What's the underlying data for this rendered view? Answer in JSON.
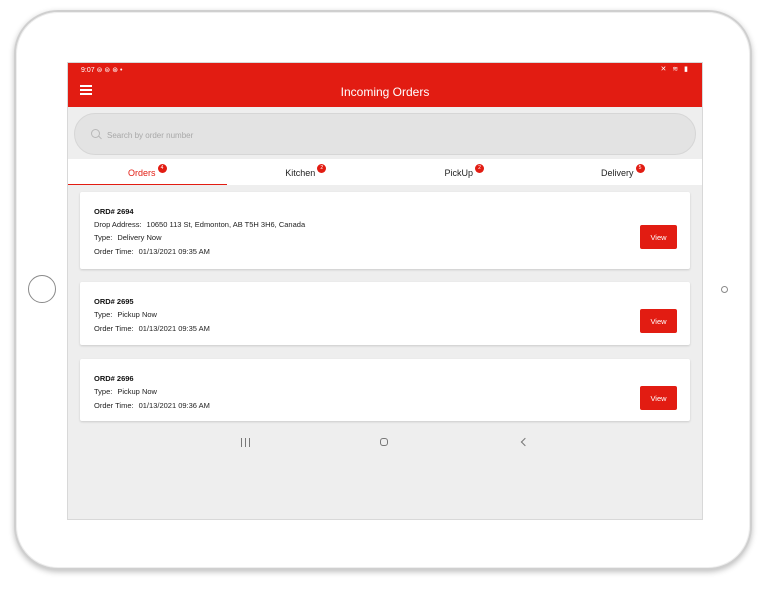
{
  "status_bar": {
    "time": "9:07",
    "left_icons": "⊜ ⊜ ⊛ •",
    "right_icons": "✕ ≋ ▮"
  },
  "app_bar": {
    "title": "Incoming Orders",
    "menu_icon": "hamburger-icon"
  },
  "search": {
    "placeholder": "Search by order number",
    "value": ""
  },
  "tabs": [
    {
      "label": "Orders",
      "badge": "4",
      "active": true
    },
    {
      "label": "Kitchen",
      "badge": "2",
      "active": false
    },
    {
      "label": "PickUp",
      "badge": "2",
      "active": false
    },
    {
      "label": "Delivery",
      "badge": "5",
      "active": false
    }
  ],
  "orders": [
    {
      "number": "ORD# 2694",
      "drop_address_label": "Drop Address:",
      "drop_address": "10650 113 St, Edmonton, AB T5H 3H6, Canada",
      "type_label": "Type:",
      "type": "Delivery Now",
      "time_label": "Order Time:",
      "time": "01/13/2021 09:35 AM",
      "button": "View"
    },
    {
      "number": "ORD# 2695",
      "type_label": "Type:",
      "type": "Pickup Now",
      "time_label": "Order Time:",
      "time": "01/13/2021 09:35 AM",
      "button": "View"
    },
    {
      "number": "ORD# 2696",
      "type_label": "Type:",
      "type": "Pickup Now",
      "time_label": "Order Time:",
      "time": "01/13/2021 09:36 AM",
      "button": "View"
    }
  ],
  "colors": {
    "accent": "#e21c12",
    "background": "#eeeeee"
  }
}
